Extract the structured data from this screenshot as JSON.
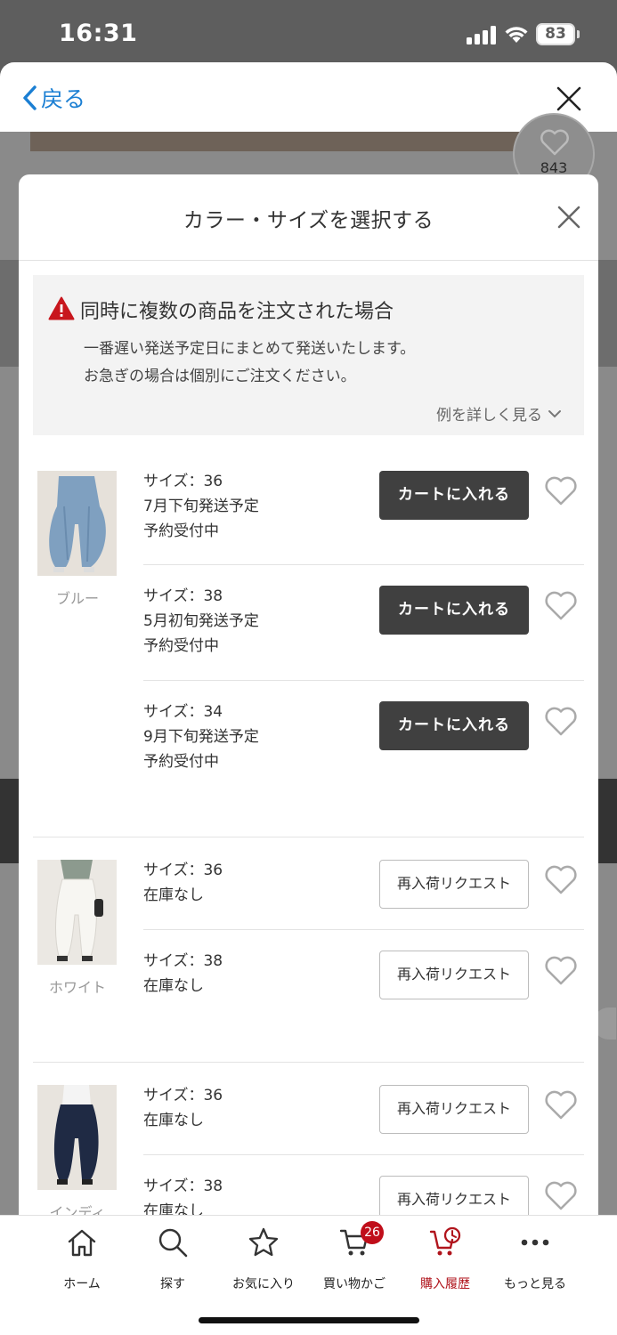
{
  "status_bar": {
    "time": "16:31",
    "battery": "83"
  },
  "back_sheet": {
    "back_label": "戻る",
    "favorite_count": "843"
  },
  "modal": {
    "title": "カラー・サイズを選択する"
  },
  "notice": {
    "title": "同時に複数の商品を注文された場合",
    "line1": "一番遅い発送予定日にまとめて発送いたします。",
    "line2": "お急ぎの場合は個別にご注文ください。",
    "more": "例を詳しく見る"
  },
  "groups": [
    {
      "color": "ブルー",
      "rows": [
        {
          "size": "サイズ：36",
          "line2": "7月下旬発送予定",
          "line3": "予約受付中",
          "button": "カートに入れる"
        },
        {
          "size": "サイズ：38",
          "line2": "5月初旬発送予定",
          "line3": "予約受付中",
          "button": "カートに入れる"
        },
        {
          "size": "サイズ：34",
          "line2": "9月下旬発送予定",
          "line3": "予約受付中",
          "button": "カートに入れる"
        }
      ]
    },
    {
      "color": "ホワイト",
      "rows": [
        {
          "size": "サイズ：36",
          "line2": "在庫なし",
          "button": "再入荷リクエスト"
        },
        {
          "size": "サイズ：38",
          "line2": "在庫なし",
          "button": "再入荷リクエスト"
        }
      ]
    },
    {
      "color": "インディ",
      "rows": [
        {
          "size": "サイズ：36",
          "line2": "在庫なし",
          "button": "再入荷リクエスト"
        },
        {
          "size": "サイズ：38",
          "line2": "在庫なし",
          "button": "再入荷リクエスト"
        }
      ]
    }
  ],
  "tabbar": {
    "items": [
      {
        "label": "ホーム",
        "icon": "home-icon"
      },
      {
        "label": "探す",
        "icon": "search-icon"
      },
      {
        "label": "お気に入り",
        "icon": "star-icon"
      },
      {
        "label": "買い物かご",
        "icon": "cart-icon",
        "badge": "26"
      },
      {
        "label": "購入履歴",
        "icon": "history-cart-icon",
        "active": true
      },
      {
        "label": "もっと見る",
        "icon": "more-icon"
      }
    ]
  },
  "colors": {
    "accent_link": "#1b7fd3",
    "cart_button": "#404040",
    "active_tab": "#b0141c",
    "badge": "#c00e1a",
    "warning": "#c8161d"
  }
}
